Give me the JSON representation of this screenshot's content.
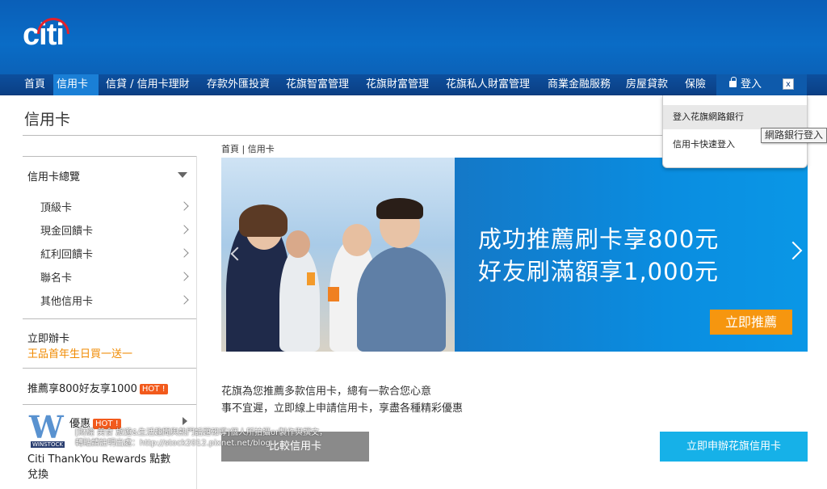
{
  "header": {
    "logo_text": "citi"
  },
  "nav": {
    "items": [
      {
        "label": "首頁"
      },
      {
        "label": "信用卡"
      },
      {
        "label": "信貸 / 信用卡理財"
      },
      {
        "label": "存款外匯投資"
      },
      {
        "label": "花旗智富管理"
      },
      {
        "label": "花旗財富管理"
      },
      {
        "label": "花旗私人財富管理"
      },
      {
        "label": "商業金融服務"
      },
      {
        "label": "房屋貸款"
      },
      {
        "label": "保險"
      }
    ],
    "login_label": "登入",
    "close_label": "x"
  },
  "login_dropdown": {
    "items": [
      "登入花旗網路銀行",
      "信用卡快速登入"
    ],
    "tooltip": "網路銀行登入"
  },
  "page": {
    "title": "信用卡",
    "breadcrumb": "首頁 | 信用卡"
  },
  "sidebar": {
    "overview_label": "信用卡總覽",
    "sub_items": [
      "頂級卡",
      "現金回饋卡",
      "紅利回饋卡",
      "聯名卡",
      "其他信用卡"
    ],
    "promo1_title": "立即辦卡",
    "promo1_sub": "王品首年生日買一送一",
    "promo2_title": "推薦享800好友享1000",
    "hot_label": "HOT !",
    "promo3_title": "優惠",
    "promo4_title": "Citi ThankYou Rewards 點數",
    "promo4_sub": "兌換"
  },
  "banner": {
    "line1": "成功推薦刷卡享800元",
    "line2": "好友刷滿額享1,000元",
    "button": "立即推薦"
  },
  "intro": {
    "line1": "花旗為您推薦多款信用卡，總有一款合您心意",
    "line2": "事不宜遲，立即線上申請信用卡，享盡各種精彩優惠"
  },
  "actions": {
    "compare": "比較信用卡",
    "apply": "立即申辦花旗信用卡"
  },
  "watermark": {
    "logo_text": "W",
    "logo_sub": "WINSTOCK",
    "line1": "[財經 美食 旅遊&生活趣聞與熱門話題報導]個人所拍攝or製作與撰文，",
    "line2": "轉貼請註明出處：http://stock2012.pixnet.net/blog"
  }
}
